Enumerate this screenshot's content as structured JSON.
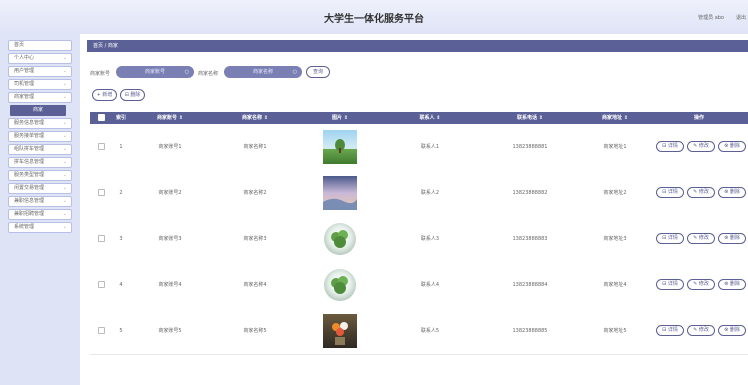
{
  "header": {
    "app_title": "大学生一体化服务平台",
    "user_text": "管理员 abo",
    "logout_label": "退出"
  },
  "sidebar": {
    "items": [
      {
        "label": "首页",
        "chevron": false
      },
      {
        "label": "个人中心",
        "chevron": true
      },
      {
        "label": "用户管理",
        "chevron": true
      },
      {
        "label": "司机管理",
        "chevron": true
      },
      {
        "label": "商家管理",
        "chevron": true
      },
      {
        "label": "服务信息管理",
        "chevron": true
      },
      {
        "label": "服务接单管理",
        "chevron": true
      },
      {
        "label": "组队拼车管理",
        "chevron": true
      },
      {
        "label": "拼车信息管理",
        "chevron": true
      },
      {
        "label": "服务类型管理",
        "chevron": true
      },
      {
        "label": "闲置交易管理",
        "chevron": true
      },
      {
        "label": "兼职信息管理",
        "chevron": true
      },
      {
        "label": "兼职招聘管理",
        "chevron": true
      },
      {
        "label": "系统管理",
        "chevron": true
      }
    ],
    "active_sub": "商家"
  },
  "breadcrumb": "首页 / 商家",
  "search": {
    "account_label": "商家账号",
    "account_placeholder": "商家账号",
    "name_label": "商家名称",
    "name_placeholder": "商家名称",
    "query_button": "查询"
  },
  "toolbar": {
    "add_label": "+ 新增",
    "delete_label": "⊟ 删除"
  },
  "table": {
    "headers": [
      "索引",
      "商家账号 ⇕",
      "商家名称 ⇕",
      "图片 ⇕",
      "联系人 ⇕",
      "联系电话 ⇕",
      "商家地址 ⇕",
      "操作"
    ],
    "rows": [
      {
        "index": "1",
        "account": "商家账号1",
        "name": "商家名称1",
        "contact": "联系人1",
        "phone": "13823888881",
        "address": "商家地址1",
        "image": "landscape-photo"
      },
      {
        "index": "2",
        "account": "商家账号2",
        "name": "商家名称2",
        "contact": "联系人2",
        "phone": "13823888882",
        "address": "商家地址2",
        "image": "sky-painting"
      },
      {
        "index": "3",
        "account": "商家账号3",
        "name": "商家名称3",
        "contact": "联系人3",
        "phone": "13823888883",
        "address": "商家地址3",
        "image": "plant-globe"
      },
      {
        "index": "4",
        "account": "商家账号4",
        "name": "商家名称4",
        "contact": "联系人4",
        "phone": "13823888884",
        "address": "商家地址4",
        "image": "plant-globe"
      },
      {
        "index": "5",
        "account": "商家账号5",
        "name": "商家名称5",
        "contact": "联系人5",
        "phone": "13823888885",
        "address": "商家地址5",
        "image": "flower-painting"
      }
    ],
    "actions": {
      "detail": "⊟ 详情",
      "edit": "✎ 修改",
      "delete": "⊗ 删除"
    }
  },
  "colors": {
    "accent": "#5b6096",
    "input_fill": "#7a7fb4",
    "page_bg": "#eeeef8"
  }
}
